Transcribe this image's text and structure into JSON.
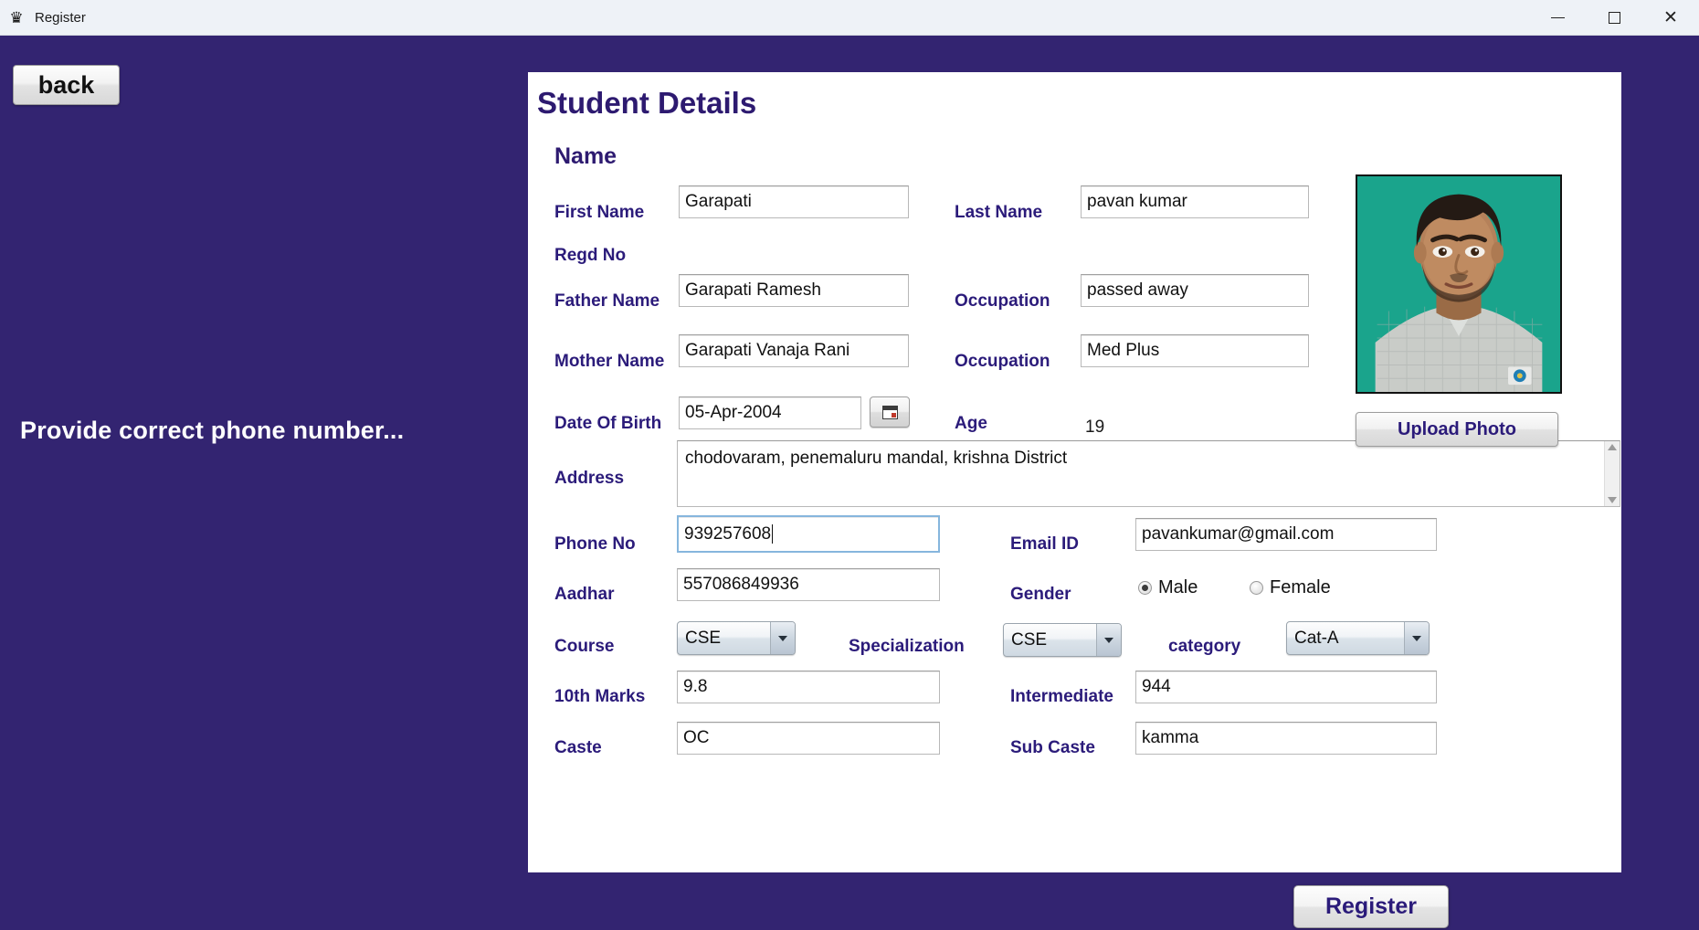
{
  "window": {
    "title": "Register",
    "icon": "app-icon",
    "controls": {
      "minimize": "minimize",
      "maximize": "maximize",
      "close": "close"
    }
  },
  "theme": {
    "background": "#332471",
    "card_background": "#ffffff",
    "label_color": "#2b1b7a",
    "title_color": "#2d1a70",
    "status_color": "#ffffff"
  },
  "left_panel": {
    "back_label": "back",
    "status_message": "Provide correct phone number..."
  },
  "form": {
    "title": "Student Details",
    "group_label": "Name",
    "fields": {
      "first_name": {
        "label": "First Name",
        "value": "Garapati"
      },
      "last_name": {
        "label": "Last Name",
        "value": "pavan kumar"
      },
      "regd_no": {
        "label": "Regd No",
        "value": ""
      },
      "father_name": {
        "label": "Father Name",
        "value": "Garapati Ramesh"
      },
      "father_occupation": {
        "label": "Occupation",
        "value": "passed away"
      },
      "mother_name": {
        "label": "Mother Name",
        "value": "Garapati Vanaja Rani"
      },
      "mother_occupation": {
        "label": "Occupation",
        "value": "Med Plus"
      },
      "date_of_birth": {
        "label": "Date Of Birth",
        "value": "05-Apr-2004",
        "picker_icon": "calendar-icon"
      },
      "age": {
        "label": "Age",
        "value": "19"
      },
      "address": {
        "label": "Address",
        "value": "chodovaram, penemaluru mandal, krishna District"
      },
      "phone_no": {
        "label": "Phone No",
        "value": "939257608",
        "focused": true
      },
      "email_id": {
        "label": "Email ID",
        "value": "pavankumar@gmail.com"
      },
      "aadhar": {
        "label": "Aadhar",
        "value": "557086849936"
      },
      "gender": {
        "label": "Gender",
        "options": [
          {
            "label": "Male",
            "selected": true
          },
          {
            "label": "Female",
            "selected": false
          }
        ]
      },
      "course": {
        "label": "Course",
        "value": "CSE"
      },
      "specialization": {
        "label": "Specialization",
        "value": "CSE"
      },
      "category": {
        "label": "category",
        "value": "Cat-A"
      },
      "tenth_marks": {
        "label": "10th Marks",
        "value": "9.8"
      },
      "intermediate": {
        "label": "Intermediate",
        "value": "944"
      },
      "caste": {
        "label": "Caste",
        "value": "OC"
      },
      "sub_caste": {
        "label": "Sub Caste",
        "value": "kamma"
      }
    },
    "photo": {
      "alt": "student-photo",
      "upload_label": "Upload Photo"
    }
  },
  "actions": {
    "register_label": "Register"
  }
}
